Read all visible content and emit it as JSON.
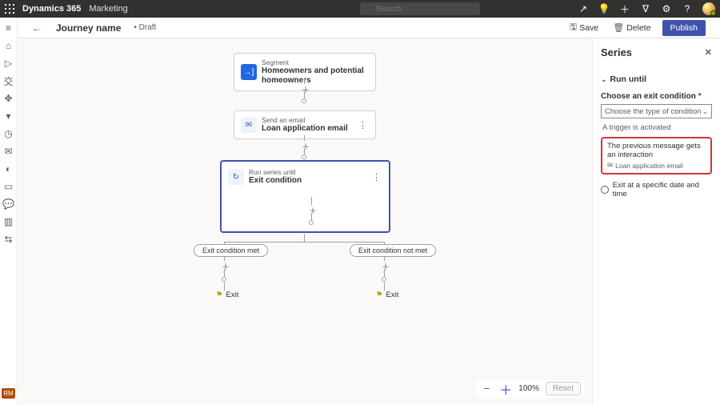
{
  "top": {
    "brand": "Dynamics 365",
    "module": "Marketing",
    "search_placeholder": "Search"
  },
  "cmd": {
    "journey_name": "Journey name",
    "draft": "• Draft",
    "save": "Save",
    "delete": "Delete",
    "publish": "Publish"
  },
  "nodes": {
    "segment": {
      "label": "Segment",
      "value": "Homeowners and potential homeowners"
    },
    "email": {
      "label": "Send an email",
      "value": "Loan application email"
    },
    "series": {
      "label": "Run series until",
      "value": "Exit condition"
    }
  },
  "branches": {
    "met": "Exit condition met",
    "notmet": "Exit condition not met",
    "exit": "Exit"
  },
  "zoom": {
    "value": "100%",
    "reset": "Reset"
  },
  "panel": {
    "title": "Series",
    "section": "Run until",
    "choose_label": "Choose an exit condition",
    "choose_placeholder": "Choose the type of condition",
    "opt_trigger": "A trigger is activated",
    "card_title": "The previous message gets an interaction",
    "card_sub": "Loan application email",
    "radio_time": "Exit at a specific date and time"
  }
}
